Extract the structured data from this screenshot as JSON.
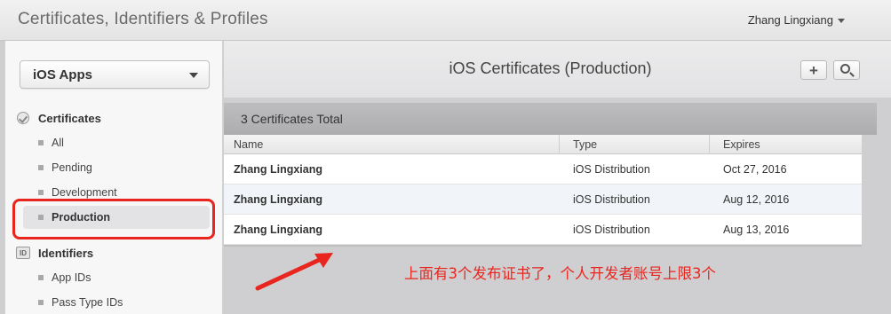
{
  "header": {
    "title": "Certificates, Identifiers & Profiles",
    "user": "Zhang Lingxiang"
  },
  "sidebar": {
    "platform": "iOS Apps",
    "sections": [
      {
        "title": "Certificates",
        "icon": "certificate-icon",
        "items": [
          {
            "label": "All"
          },
          {
            "label": "Pending"
          },
          {
            "label": "Development"
          },
          {
            "label": "Production"
          }
        ]
      },
      {
        "title": "Identifiers",
        "icon": "id-badge-icon",
        "icon_text": "ID",
        "items": [
          {
            "label": "App IDs"
          },
          {
            "label": "Pass Type IDs"
          }
        ]
      }
    ]
  },
  "main": {
    "title": "iOS Certificates (Production)",
    "total": "3 Certificates Total",
    "columns": [
      "Name",
      "Type",
      "Expires"
    ],
    "rows": [
      {
        "name": "Zhang Lingxiang",
        "type": "iOS Distribution",
        "expires": "Oct 27, 2016"
      },
      {
        "name": "Zhang Lingxiang",
        "type": "iOS Distribution",
        "expires": "Aug 12, 2016"
      },
      {
        "name": "Zhang Lingxiang",
        "type": "iOS Distribution",
        "expires": "Aug 13, 2016"
      }
    ]
  },
  "annotation": {
    "text": "上面有3个发布证书了，个人开发者账号上限3个",
    "color": "#e8261f"
  }
}
